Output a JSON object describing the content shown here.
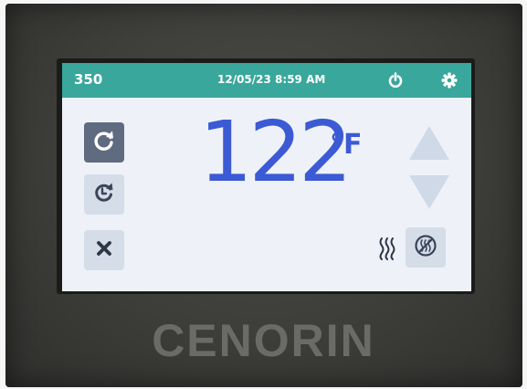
{
  "status_bar": {
    "unit_id": "350",
    "datetime": "12/05/23 8:59 AM",
    "power_icon": "power-icon",
    "settings_icon": "gear-icon",
    "color": "#39a79b"
  },
  "left_controls": [
    {
      "name": "refresh",
      "icon": "refresh-icon",
      "selected": true
    },
    {
      "name": "timer",
      "icon": "timer-icon",
      "selected": false
    },
    {
      "name": "cancel",
      "icon": "close-icon",
      "selected": false
    }
  ],
  "temperature": {
    "value": "122",
    "unit": "°F",
    "color": "#3c5ad4"
  },
  "right_controls": {
    "up_icon": "triangle-up-icon",
    "down_icon": "triangle-down-icon",
    "heat_icon": "heat-waves-icon",
    "heat_off_icon": "heat-off-icon"
  },
  "brand": {
    "name": "CENORIN"
  }
}
